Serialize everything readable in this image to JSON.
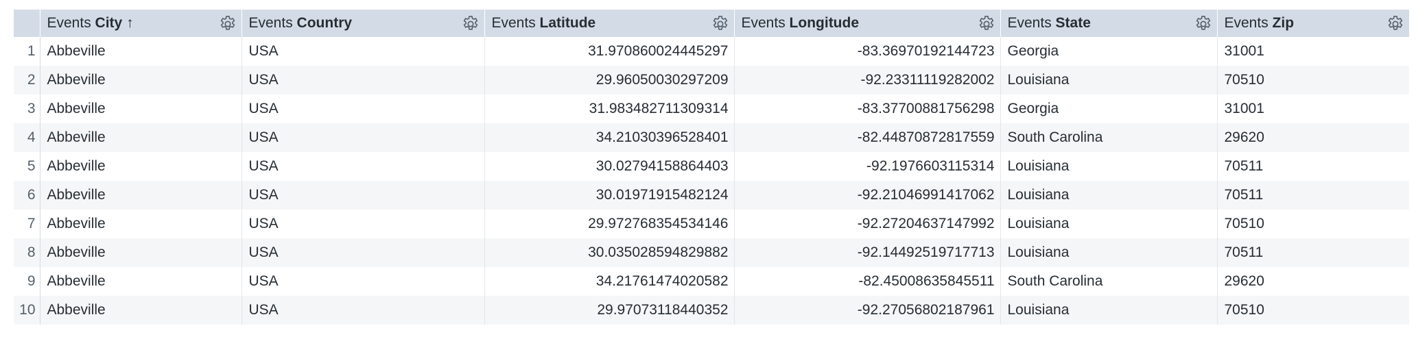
{
  "table": {
    "columns": [
      {
        "prefix": "Events",
        "name": "City",
        "sort": "↑",
        "gear_icon": "gear-icon"
      },
      {
        "prefix": "Events",
        "name": "Country",
        "sort": "",
        "gear_icon": "gear-icon"
      },
      {
        "prefix": "Events",
        "name": "Latitude",
        "sort": "",
        "gear_icon": "gear-icon"
      },
      {
        "prefix": "Events",
        "name": "Longitude",
        "sort": "",
        "gear_icon": "gear-icon"
      },
      {
        "prefix": "Events",
        "name": "State",
        "sort": "",
        "gear_icon": "gear-icon"
      },
      {
        "prefix": "Events",
        "name": "Zip",
        "sort": "",
        "gear_icon": "gear-icon"
      }
    ],
    "rows": [
      {
        "index": "1",
        "city": "Abbeville",
        "country": "USA",
        "latitude": "31.970860024445297",
        "longitude": "-83.36970192144723",
        "state": "Georgia",
        "zip": "31001"
      },
      {
        "index": "2",
        "city": "Abbeville",
        "country": "USA",
        "latitude": "29.96050030297209",
        "longitude": "-92.23311119282002",
        "state": "Louisiana",
        "zip": "70510"
      },
      {
        "index": "3",
        "city": "Abbeville",
        "country": "USA",
        "latitude": "31.983482711309314",
        "longitude": "-83.37700881756298",
        "state": "Georgia",
        "zip": "31001"
      },
      {
        "index": "4",
        "city": "Abbeville",
        "country": "USA",
        "latitude": "34.21030396528401",
        "longitude": "-82.44870872817559",
        "state": "South Carolina",
        "zip": "29620"
      },
      {
        "index": "5",
        "city": "Abbeville",
        "country": "USA",
        "latitude": "30.02794158864403",
        "longitude": "-92.1976603115314",
        "state": "Louisiana",
        "zip": "70511"
      },
      {
        "index": "6",
        "city": "Abbeville",
        "country": "USA",
        "latitude": "30.01971915482124",
        "longitude": "-92.21046991417062",
        "state": "Louisiana",
        "zip": "70511"
      },
      {
        "index": "7",
        "city": "Abbeville",
        "country": "USA",
        "latitude": "29.972768354534146",
        "longitude": "-92.27204637147992",
        "state": "Louisiana",
        "zip": "70510"
      },
      {
        "index": "8",
        "city": "Abbeville",
        "country": "USA",
        "latitude": "30.035028594829882",
        "longitude": "-92.14492519717713",
        "state": "Louisiana",
        "zip": "70511"
      },
      {
        "index": "9",
        "city": "Abbeville",
        "country": "USA",
        "latitude": "34.21761474020582",
        "longitude": "-82.45008635845511",
        "state": "South Carolina",
        "zip": "29620"
      },
      {
        "index": "10",
        "city": "Abbeville",
        "country": "USA",
        "latitude": "29.97073118440352",
        "longitude": "-92.27056802187961",
        "state": "Louisiana",
        "zip": "70510"
      }
    ]
  }
}
